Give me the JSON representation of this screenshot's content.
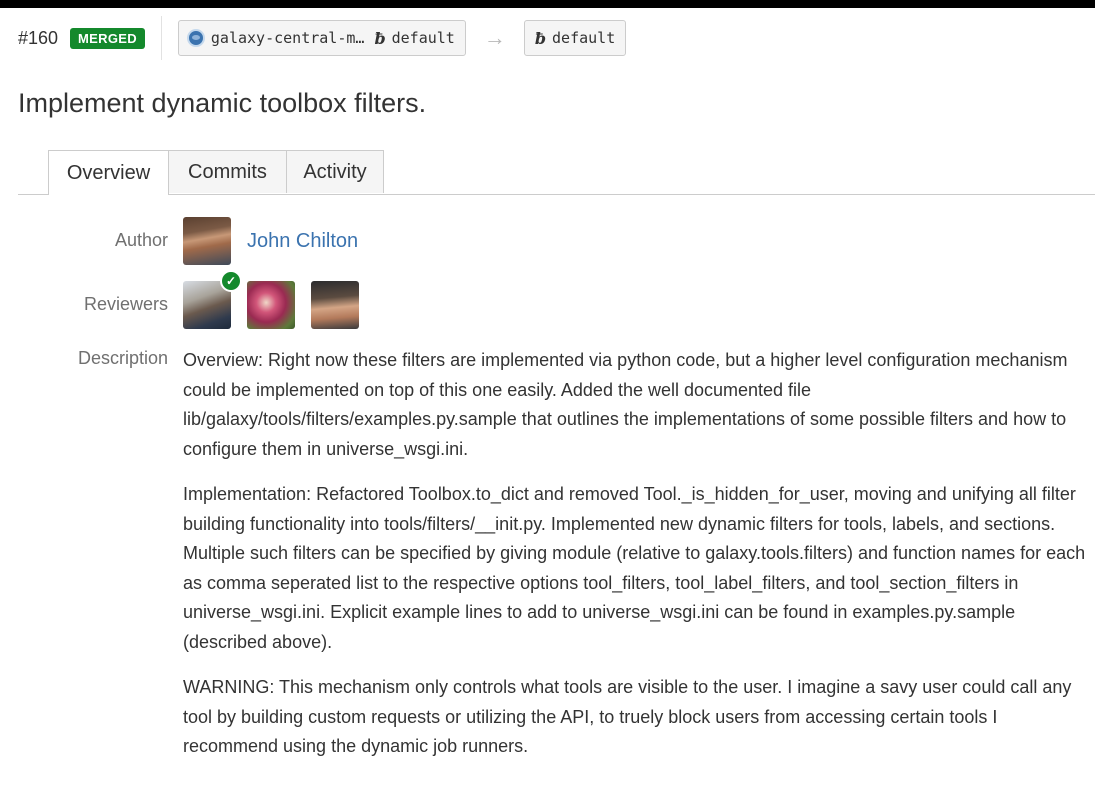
{
  "pr": {
    "number": "#160",
    "status": "MERGED",
    "status_color": "#14892c"
  },
  "source": {
    "repo": "galaxy-central-m…",
    "repo_icon": "repository-icon",
    "branch_icon": "branch-icon",
    "branch": "default"
  },
  "target": {
    "branch_icon": "branch-icon",
    "branch": "default"
  },
  "arrow_icon": "right-arrow-icon",
  "title": "Implement dynamic toolbox filters.",
  "tabs": [
    {
      "label": "Overview",
      "active": true
    },
    {
      "label": "Commits",
      "active": false
    },
    {
      "label": "Activity",
      "active": false
    }
  ],
  "author": {
    "label": "Author",
    "name": "John Chilton",
    "link_color": "#3b73af"
  },
  "reviewers": {
    "label": "Reviewers",
    "approved_icon": "checkmark-icon",
    "items": [
      {
        "avatar": "reviewer-avatar-1",
        "approved": true
      },
      {
        "avatar": "reviewer-avatar-2",
        "approved": false
      },
      {
        "avatar": "reviewer-avatar-3",
        "approved": false
      }
    ]
  },
  "description": {
    "label": "Description",
    "paragraphs": [
      "Overview: Right now these filters are implemented via python code, but a higher level configuration mechanism could be implemented on top of this one easily. Added the well documented file lib/galaxy/tools/filters/examples.py.sample that outlines the implementations of some possible filters and how to configure them in universe_wsgi.ini.",
      "Implementation: Refactored Toolbox.to_dict and removed Tool._is_hidden_for_user, moving and unifying all filter building functionality into tools/filters/__init.py. Implemented new dynamic filters for tools, labels, and sections. Multiple such filters can be specified by giving module (relative to galaxy.tools.filters) and function names for each as comma seperated list to the respective options tool_filters, tool_label_filters, and tool_section_filters in universe_wsgi.ini. Explicit example lines to add to universe_wsgi.ini can be found in examples.py.sample (described above).",
      "WARNING: This mechanism only controls what tools are visible to the user. I imagine a savy user could call any tool by building custom requests or utilizing the API, to truely block users from accessing certain tools I recommend using the dynamic job runners."
    ]
  }
}
